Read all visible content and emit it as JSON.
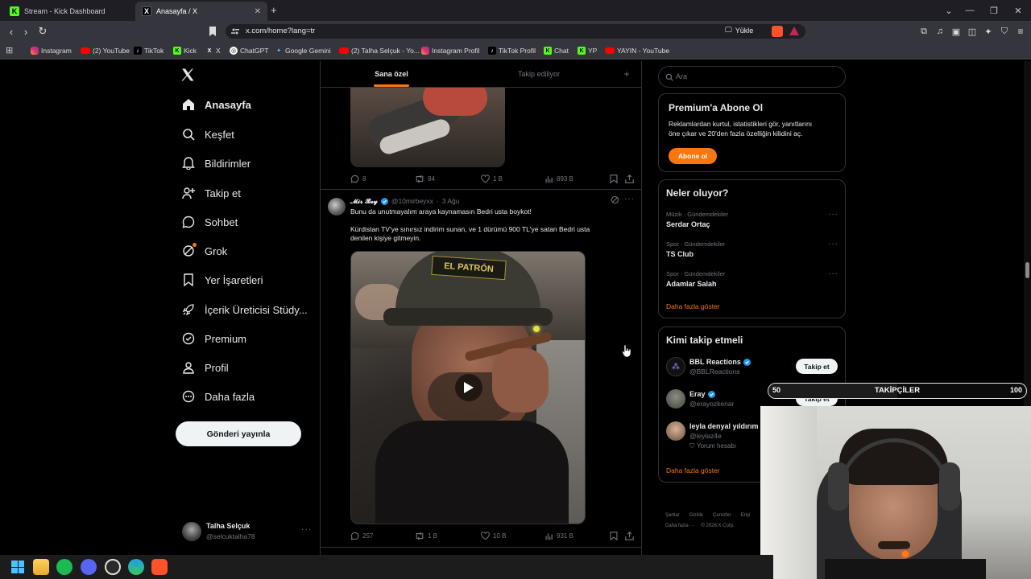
{
  "browser": {
    "tabs": [
      {
        "title": "Stream - Kick Dashboard",
        "icon": "kick-icon"
      },
      {
        "title": "Anasayfa / X",
        "icon": "x-icon"
      }
    ],
    "url": "x.com/home?lang=tr",
    "install_label": "Yükle",
    "bookmarks": [
      {
        "label": "Instagram",
        "icon": "instagram-icon"
      },
      {
        "label": "(2) YouTube",
        "icon": "youtube-icon"
      },
      {
        "label": "TikTok",
        "icon": "tiktok-icon"
      },
      {
        "label": "Kick",
        "icon": "kick-icon"
      },
      {
        "label": "X",
        "icon": "x-icon"
      },
      {
        "label": "ChatGPT",
        "icon": "chatgpt-icon"
      },
      {
        "label": "Google Gemini",
        "icon": "gemini-icon"
      },
      {
        "label": "(2) Talha Selçuk - Yo...",
        "icon": "youtube-icon"
      },
      {
        "label": "Instagram Profil",
        "icon": "instagram-icon"
      },
      {
        "label": "TikTok Profil",
        "icon": "tiktok-icon"
      },
      {
        "label": "Chat",
        "icon": "kick-icon"
      },
      {
        "label": "YP",
        "icon": "kick-icon"
      },
      {
        "label": "YAYIN - YouTube",
        "icon": "youtube-icon"
      }
    ]
  },
  "sidebar": {
    "nav": [
      {
        "label": "Anasayfa",
        "icon": "home-icon"
      },
      {
        "label": "Keşfet",
        "icon": "search-icon"
      },
      {
        "label": "Bildirimler",
        "icon": "bell-icon"
      },
      {
        "label": "Takip et",
        "icon": "add-user-icon"
      },
      {
        "label": "Sohbet",
        "icon": "chat-icon"
      },
      {
        "label": "Grok",
        "icon": "grok-icon"
      },
      {
        "label": "Yer İşaretleri",
        "icon": "bookmark-icon"
      },
      {
        "label": "İçerik Üreticisi Stüdy...",
        "icon": "rocket-icon"
      },
      {
        "label": "Premium",
        "icon": "verified-icon"
      },
      {
        "label": "Profil",
        "icon": "profile-icon"
      },
      {
        "label": "Daha fazla",
        "icon": "more-icon"
      }
    ],
    "post_button": "Gönderi yayınla",
    "account": {
      "name": "Talha Selçuk",
      "handle": "@selcuktalha78"
    }
  },
  "feed": {
    "tabs": [
      "Sana özel",
      "Takip ediliyor"
    ],
    "post1_stats": {
      "replies": "8",
      "reposts": "84",
      "likes": "1 B",
      "views": "893 B"
    },
    "post2": {
      "author": "𝓜𝓲𝓻 𝓑𝓮𝔂",
      "handle": "@10mirbeyxx",
      "time": "3 Ağu",
      "line1": "Bunu da unutmayalım araya kaynamasın Bedri usta boykot!",
      "line2": "Kürdistan TV'ye sınırsız indirim sunan,  ve 1 dürümü 900 TL'ye satan Bedri usta",
      "line3": "denilen kişiye gitmeyin.",
      "cap_text": "EL PATRÓN",
      "stats": {
        "replies": "257",
        "reposts": "1 B",
        "likes": "10 B",
        "views": "931 B"
      }
    }
  },
  "right": {
    "search_placeholder": "Ara",
    "premium": {
      "title": "Premium'a Abone Ol",
      "text1": "Reklamlardan kurtul, istatistikleri gör, yanıtlarını",
      "text2": "öne çıkar ve 20'den fazla özelliğin kilidini aç.",
      "button": "Abone ol"
    },
    "trends": {
      "title": "Neler oluyor?",
      "items": [
        {
          "meta": "Müzik · Gündemdekiler",
          "name": "Serdar Ortaç"
        },
        {
          "meta": "Spor · Gündemdekiler",
          "name": "TS Club"
        },
        {
          "meta": "Spor · Gündemdekiler",
          "name": "Adamlar Salah"
        }
      ],
      "show_more": "Daha fazla göster"
    },
    "who_to_follow": {
      "title": "Kimi takip etmeli",
      "users": [
        {
          "name": "BBL Reactions",
          "handle": "@BBLReactions"
        },
        {
          "name": "Eray",
          "handle": "@erayozkenar"
        },
        {
          "name": "leyla denyal yıldırım",
          "handle": "@leylaz4e",
          "note": "Yorum hesabı"
        }
      ],
      "follow_label": "Takip et",
      "show_more": "Daha fazla göster"
    },
    "footer": {
      "links": [
        "Şartlar",
        "Gizlilik",
        "Çerezler",
        "Erişi"
      ],
      "more": "Daha fazla ···",
      "copyright": "© 2026 X Corp."
    }
  },
  "overlay": {
    "follower_goal": {
      "current": "50",
      "label": "TAKİPÇİLER",
      "target": "100",
      "progress": 0.5
    }
  },
  "colors": {
    "accent": "#f9770c",
    "kick": "#53fc18",
    "verified": "#1d9bf0"
  }
}
